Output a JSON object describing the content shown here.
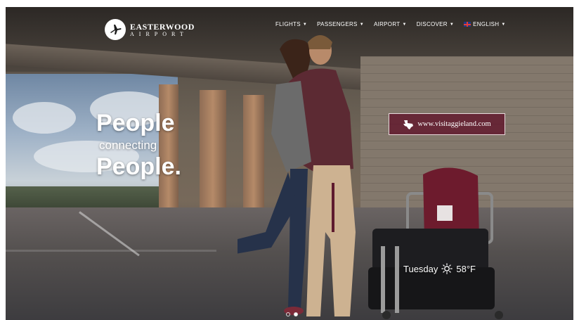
{
  "brand": {
    "name": "EASTERWOOD",
    "subtitle": "AIRPORT"
  },
  "nav": {
    "items": [
      {
        "label": "FLIGHTS"
      },
      {
        "label": "PASSENGERS"
      },
      {
        "label": "AIRPORT"
      },
      {
        "label": "DISCOVER"
      },
      {
        "label": "ENGLISH"
      }
    ],
    "chevron_icon": "chevron-down-icon",
    "language_icon": "uk-flag-icon"
  },
  "hero": {
    "line1": "People",
    "line2": "connecting",
    "line3": "People."
  },
  "cta": {
    "label": "www.visitaggieland.com",
    "icon": "texas-state-icon",
    "color": "#5e1a2e"
  },
  "weather": {
    "day": "Tuesday",
    "temperature": "58°F",
    "icon": "sun-icon"
  },
  "carousel": {
    "slides": 2,
    "active_index": 1
  }
}
